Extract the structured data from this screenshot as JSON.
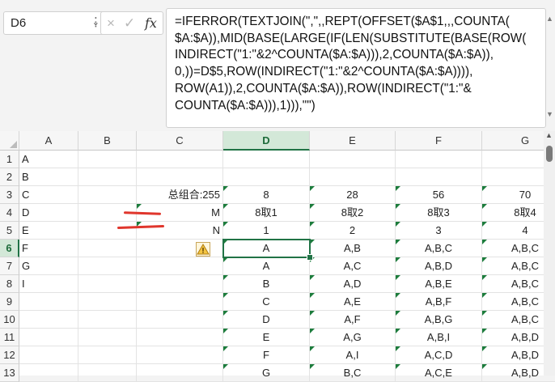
{
  "name_box": {
    "value": "D6"
  },
  "formula_bar": {
    "cancel_glyph": "×",
    "enter_glyph": "✓",
    "fx_label": "fx",
    "formula": "=IFERROR(TEXTJOIN(\",\",,REPT(OFFSET($A$1,,,COUNTA(\n$A:$A)),MID(BASE(LARGE(IF(LEN(SUBSTITUTE(BASE(ROW(\nINDIRECT(\"1:\"&2^COUNTA($A:$A))),2,COUNTA($A:$A)),\n0,))=D$5,ROW(INDIRECT(\"1:\"&2^COUNTA($A:$A)))),\nROW(A1)),2,COUNTA($A:$A)),ROW(INDIRECT(\"1:\"&\nCOUNTA($A:$A))),1))),\"\")"
  },
  "sheet": {
    "columns": [
      "A",
      "B",
      "C",
      "D",
      "E",
      "F",
      "G"
    ],
    "rows": [
      "1",
      "2",
      "3",
      "4",
      "5",
      "6",
      "7",
      "8",
      "9",
      "10",
      "11",
      "12",
      "13"
    ],
    "selected_cell": "D6",
    "accent_color": "#217346",
    "annotation_color": "#e0362c",
    "cells": {
      "A": [
        "A",
        "B",
        "C",
        "D",
        "E",
        "F",
        "G",
        "I",
        "",
        "",
        "",
        "",
        ""
      ],
      "C": [
        "",
        "",
        "总组合:255",
        "M",
        "N",
        "",
        "",
        "",
        "",
        "",
        "",
        "",
        ""
      ],
      "D": [
        "",
        "",
        "8",
        "8取1",
        "1",
        "A",
        "A",
        "B",
        "C",
        "D",
        "E",
        "F",
        "G"
      ],
      "E": [
        "",
        "",
        "28",
        "8取2",
        "2",
        "A,B",
        "A,C",
        "A,D",
        "A,E",
        "A,F",
        "A,G",
        "A,I",
        "B,C"
      ],
      "F": [
        "",
        "",
        "56",
        "8取3",
        "3",
        "A,B,C",
        "A,B,D",
        "A,B,E",
        "A,B,F",
        "A,B,G",
        "A,B,I",
        "A,C,D",
        "A,C,E"
      ],
      "G": [
        "",
        "",
        "70",
        "8取4",
        "4",
        "A,B,C",
        "A,B,C",
        "A,B,C",
        "A,B,C",
        "A,B,C",
        "A,B,D",
        "A,B,D",
        "A,B,D"
      ]
    }
  }
}
